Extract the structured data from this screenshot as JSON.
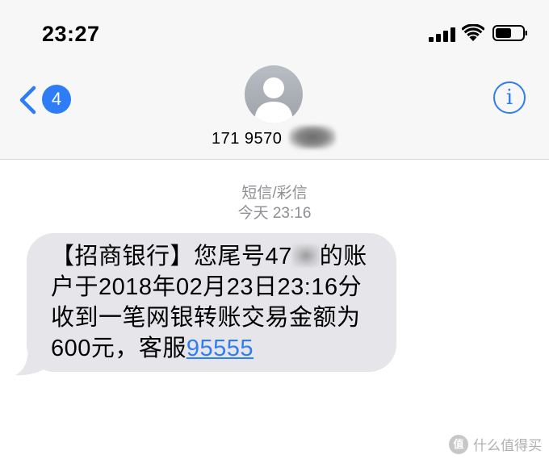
{
  "status_bar": {
    "time": "23:27"
  },
  "header": {
    "back_badge": "4",
    "contact_number": "171 9570 ",
    "info_icon": "info-icon"
  },
  "conversation": {
    "message_type": "短信/彩信",
    "timestamp": "今天 23:16",
    "message": {
      "part1": "【招商银行】您尾号47",
      "part2": "的账户于2018年02月23日23:16分收到一笔网银转账交易金额为600元，客服",
      "phone": "95555"
    }
  },
  "watermark": {
    "logo": "值",
    "text": "什么值得买"
  },
  "colors": {
    "accent": "#2f7df6",
    "bubble": "#e5e5ea",
    "header_bg": "#f7f7f7"
  }
}
